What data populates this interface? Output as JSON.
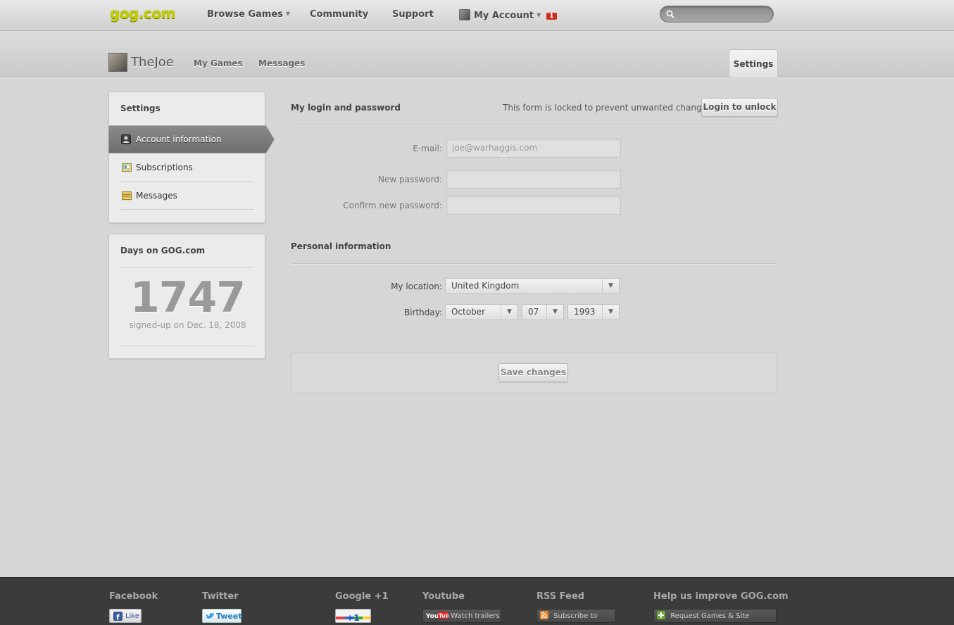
{
  "header": {
    "logo": "gog.com",
    "nav": [
      {
        "label": "Browse Games",
        "has_dropdown": true
      },
      {
        "label": "Community"
      },
      {
        "label": "Support"
      }
    ],
    "account": {
      "label": "My Account",
      "badge": "1"
    },
    "search": {
      "value": "",
      "placeholder": ""
    }
  },
  "profile": {
    "username": "TheJoe",
    "tabs": [
      "My Games",
      "Messages"
    ],
    "active_tab": "Settings"
  },
  "sidebar": {
    "title": "Settings",
    "items": [
      {
        "label": "Account information",
        "icon": "user-icon",
        "active": true
      },
      {
        "label": "Subscriptions",
        "icon": "newsletter-icon"
      },
      {
        "label": "Messages",
        "icon": "envelope-icon"
      }
    ]
  },
  "days_panel": {
    "title": "Days on GOG.com",
    "count": "1747",
    "signed_up": "signed-up on Dec. 18, 2008"
  },
  "login_section": {
    "title": "My login and password",
    "lock_note": "This form is locked to prevent unwanted changes.",
    "unlock_button": "Login to unlock",
    "email_label": "E-mail:",
    "email_value": "joe@warhaggis.com",
    "new_password_label": "New password:",
    "confirm_password_label": "Confirm new password:"
  },
  "personal_section": {
    "title": "Personal information",
    "location_label": "My location:",
    "location_value": "United Kingdom",
    "birthday_label": "Birthday:",
    "birthday_month": "October",
    "birthday_day": "07",
    "birthday_year": "1993"
  },
  "save_button": "Save changes",
  "footer": {
    "columns": [
      {
        "title": "Facebook",
        "button": "Like"
      },
      {
        "title": "Twitter",
        "button": "Tweet"
      },
      {
        "title": "Google +1",
        "button": "+1"
      },
      {
        "title": "Youtube",
        "button": "Watch trailers"
      },
      {
        "title": "RSS Feed",
        "button": "Subscribe to news"
      },
      {
        "title": "Help us improve GOG.com",
        "button": "Request Games & Site features"
      }
    ]
  },
  "colors": {
    "logo": "#c4d100",
    "badge": "#c9301d",
    "footer_bg": "#3b3b3b",
    "active_menu": "#7a7a7a"
  }
}
